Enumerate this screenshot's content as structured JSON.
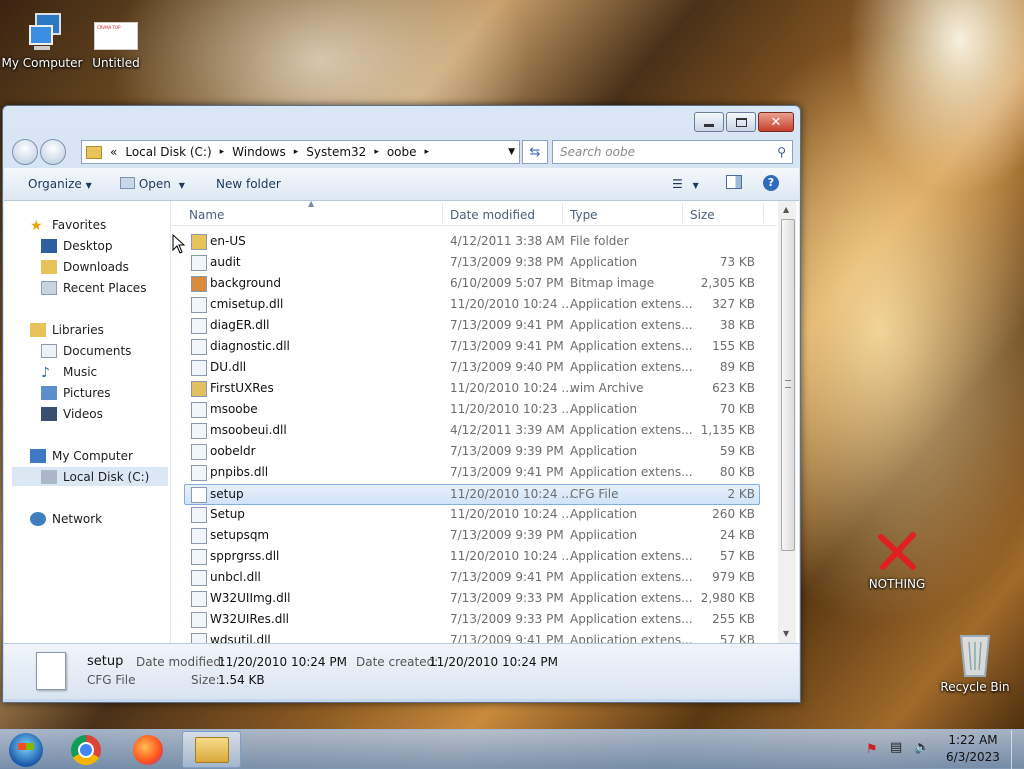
{
  "desktop": {
    "icons": [
      {
        "label": "My Computer"
      },
      {
        "label": "Untitled",
        "thumb_text": "CRVMA TOP"
      },
      {
        "label": "NOTHING"
      },
      {
        "label": "Recycle Bin"
      }
    ]
  },
  "window": {
    "breadcrumb": [
      "«",
      "Local Disk (C:)",
      "▸",
      "Windows",
      "▸",
      "System32",
      "▸",
      "oobe",
      "▸"
    ],
    "search_placeholder": "Search oobe",
    "toolbar": {
      "organize": "Organize",
      "open": "Open",
      "new_folder": "New folder"
    },
    "nav": {
      "favorites": "Favorites",
      "desktop": "Desktop",
      "downloads": "Downloads",
      "recent": "Recent Places",
      "libraries": "Libraries",
      "documents": "Documents",
      "music": "Music",
      "pictures": "Pictures",
      "videos": "Videos",
      "computer": "My Computer",
      "local_disk": "Local Disk (C:)",
      "network": "Network"
    },
    "columns": {
      "name": "Name",
      "date": "Date modified",
      "type": "Type",
      "size": "Size"
    },
    "files": [
      {
        "name": "en-US",
        "date": "4/12/2011 3:38 AM",
        "type": "File folder",
        "size": ""
      },
      {
        "name": "audit",
        "date": "7/13/2009 9:38 PM",
        "type": "Application",
        "size": "73 KB"
      },
      {
        "name": "background",
        "date": "6/10/2009 5:07 PM",
        "type": "Bitmap image",
        "size": "2,305 KB"
      },
      {
        "name": "cmisetup.dll",
        "date": "11/20/2010 10:24 ...",
        "type": "Application extens...",
        "size": "327 KB"
      },
      {
        "name": "diagER.dll",
        "date": "7/13/2009 9:41 PM",
        "type": "Application extens...",
        "size": "38 KB"
      },
      {
        "name": "diagnostic.dll",
        "date": "7/13/2009 9:41 PM",
        "type": "Application extens...",
        "size": "155 KB"
      },
      {
        "name": "DU.dll",
        "date": "7/13/2009 9:40 PM",
        "type": "Application extens...",
        "size": "89 KB"
      },
      {
        "name": "FirstUXRes",
        "date": "11/20/2010 10:24 ...",
        "type": "wim Archive",
        "size": "623 KB"
      },
      {
        "name": "msoobe",
        "date": "11/20/2010 10:23 ...",
        "type": "Application",
        "size": "70 KB"
      },
      {
        "name": "msoobeui.dll",
        "date": "4/12/2011 3:39 AM",
        "type": "Application extens...",
        "size": "1,135 KB"
      },
      {
        "name": "oobeldr",
        "date": "7/13/2009 9:39 PM",
        "type": "Application",
        "size": "59 KB"
      },
      {
        "name": "pnpibs.dll",
        "date": "7/13/2009 9:41 PM",
        "type": "Application extens...",
        "size": "80 KB"
      },
      {
        "name": "setup",
        "date": "11/20/2010 10:24 ...",
        "type": "CFG File",
        "size": "2 KB",
        "selected": true
      },
      {
        "name": "Setup",
        "date": "11/20/2010 10:24 ...",
        "type": "Application",
        "size": "260 KB"
      },
      {
        "name": "setupsqm",
        "date": "7/13/2009 9:39 PM",
        "type": "Application",
        "size": "24 KB"
      },
      {
        "name": "spprgrss.dll",
        "date": "11/20/2010 10:24 ...",
        "type": "Application extens...",
        "size": "57 KB"
      },
      {
        "name": "unbcl.dll",
        "date": "7/13/2009 9:41 PM",
        "type": "Application extens...",
        "size": "979 KB"
      },
      {
        "name": "W32UIImg.dll",
        "date": "7/13/2009 9:33 PM",
        "type": "Application extens...",
        "size": "2,980 KB"
      },
      {
        "name": "W32UIRes.dll",
        "date": "7/13/2009 9:33 PM",
        "type": "Application extens...",
        "size": "255 KB"
      },
      {
        "name": "wdsutil.dll",
        "date": "7/13/2009 9:41 PM",
        "type": "Application extens...",
        "size": "57 KB"
      }
    ],
    "details": {
      "name": "setup",
      "type": "CFG File",
      "modified_label": "Date modified:",
      "modified": "11/20/2010 10:24 PM",
      "created_label": "Date created:",
      "created": "11/20/2010 10:24 PM",
      "size_label": "Size:",
      "size": "1.54 KB"
    }
  },
  "taskbar": {
    "time": "1:22 AM",
    "date": "6/3/2023"
  }
}
